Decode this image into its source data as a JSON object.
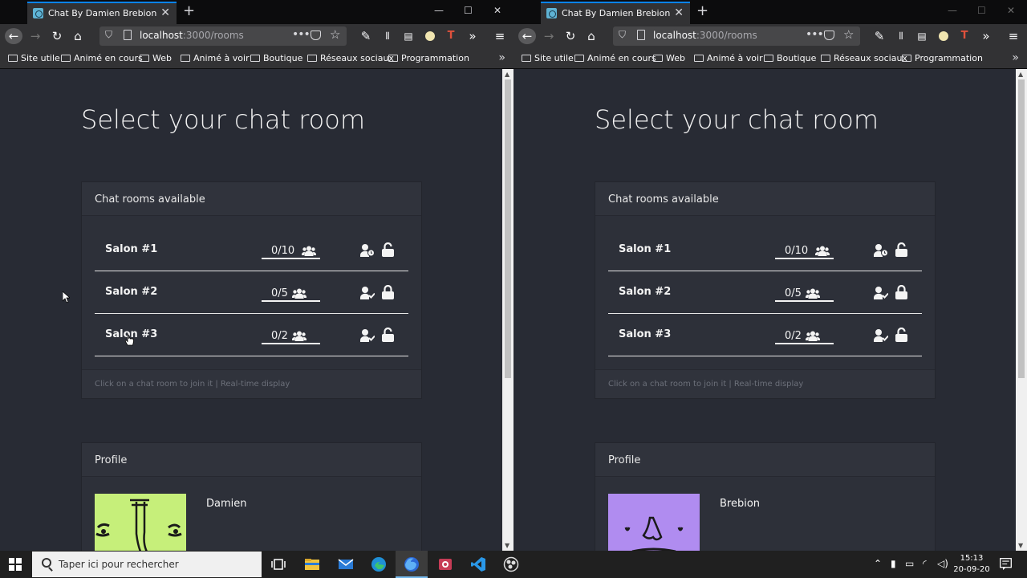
{
  "browser": {
    "tab_title": "Chat By Damien Brebion",
    "url_host": "localhost",
    "url_path": ":3000/rooms",
    "bookmarks": [
      "Site utile",
      "Animé en cours",
      "Web",
      "Animé à voir",
      "Boutique",
      "Réseaux sociaux",
      "Programmation"
    ]
  },
  "page": {
    "heading": "Select your chat room",
    "rooms_header": "Chat rooms available",
    "rooms_footer": "Click on a chat room to join it | Real-time display",
    "profile_header": "Profile"
  },
  "windows": [
    {
      "rooms": [
        {
          "name": "Salon #1",
          "count": "0/10",
          "lock": "unlocked",
          "member_icon": "user-clock-icon"
        },
        {
          "name": "Salon #2",
          "count": "0/5",
          "lock": "locked",
          "member_icon": "user-check-icon"
        },
        {
          "name": "Salon #3",
          "count": "0/2",
          "lock": "unlocked",
          "member_icon": "user-check-icon"
        }
      ],
      "profile_name": "Damien",
      "avatar_color": "#c6ef7a"
    },
    {
      "rooms": [
        {
          "name": "Salon #1",
          "count": "0/10",
          "lock": "unlocked",
          "member_icon": "user-clock-icon"
        },
        {
          "name": "Salon #2",
          "count": "0/5",
          "lock": "locked",
          "member_icon": "user-check-icon"
        },
        {
          "name": "Salon #3",
          "count": "0/2",
          "lock": "unlocked",
          "member_icon": "user-check-icon"
        }
      ],
      "profile_name": "Brebion",
      "avatar_color": "#b08cf0"
    }
  ],
  "taskbar": {
    "search_placeholder": "Taper ici pour rechercher",
    "time": "15:13",
    "date": "20-09-20"
  },
  "colors": {
    "page_background": "#282b34",
    "card_background": "#2d3039",
    "tab_accent": "#0a84ff"
  }
}
